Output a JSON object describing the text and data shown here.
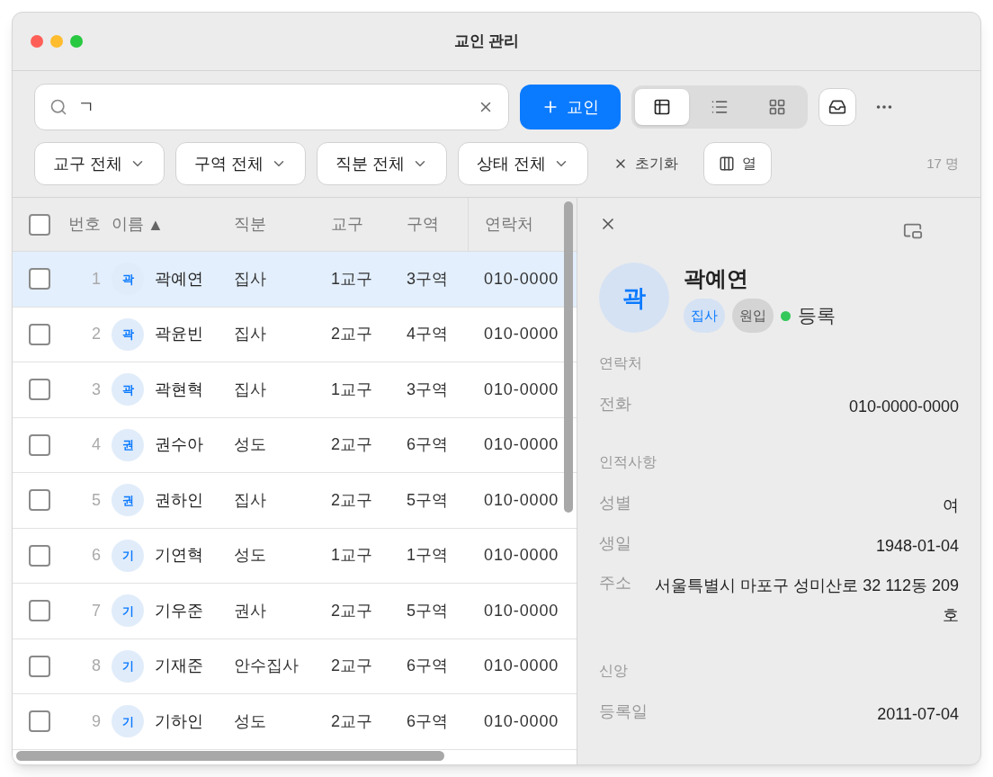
{
  "window": {
    "title": "교인 관리"
  },
  "search": {
    "value": "ㄱ"
  },
  "add_button": {
    "label": "교인"
  },
  "view_modes": [
    {
      "kind": "table",
      "selected": true
    },
    {
      "kind": "list",
      "selected": false
    },
    {
      "kind": "grid",
      "selected": false
    }
  ],
  "filters": [
    "교구 전체",
    "구역 전체",
    "직분 전체",
    "상태 전체"
  ],
  "reset_button": {
    "label": "초기화"
  },
  "columns_button": {
    "label": "열"
  },
  "count": "17 명",
  "table": {
    "columns": [
      {
        "label": "번호"
      },
      {
        "label": "이름",
        "sort_indicator": "▲"
      },
      {
        "label": "직분"
      },
      {
        "label": "교구"
      },
      {
        "label": "구역"
      },
      {
        "label": "연락처"
      }
    ],
    "all_checked": false,
    "rows": [
      {
        "checked": false,
        "selected": true,
        "number": "1",
        "initial": "곽",
        "name": "곽예연",
        "role": "집사",
        "parish": "1교구",
        "zone": "3구역",
        "phone": "010-0000"
      },
      {
        "checked": false,
        "selected": false,
        "number": "2",
        "initial": "곽",
        "name": "곽윤빈",
        "role": "집사",
        "parish": "2교구",
        "zone": "4구역",
        "phone": "010-0000"
      },
      {
        "checked": false,
        "selected": false,
        "number": "3",
        "initial": "곽",
        "name": "곽현혁",
        "role": "집사",
        "parish": "1교구",
        "zone": "3구역",
        "phone": "010-0000"
      },
      {
        "checked": false,
        "selected": false,
        "number": "4",
        "initial": "권",
        "name": "권수아",
        "role": "성도",
        "parish": "2교구",
        "zone": "6구역",
        "phone": "010-0000"
      },
      {
        "checked": false,
        "selected": false,
        "number": "5",
        "initial": "권",
        "name": "권하인",
        "role": "집사",
        "parish": "2교구",
        "zone": "5구역",
        "phone": "010-0000"
      },
      {
        "checked": false,
        "selected": false,
        "number": "6",
        "initial": "기",
        "name": "기연혁",
        "role": "성도",
        "parish": "1교구",
        "zone": "1구역",
        "phone": "010-0000"
      },
      {
        "checked": false,
        "selected": false,
        "number": "7",
        "initial": "기",
        "name": "기우준",
        "role": "권사",
        "parish": "2교구",
        "zone": "5구역",
        "phone": "010-0000"
      },
      {
        "checked": false,
        "selected": false,
        "number": "8",
        "initial": "기",
        "name": "기재준",
        "role": "안수집사",
        "parish": "2교구",
        "zone": "6구역",
        "phone": "010-0000"
      },
      {
        "checked": false,
        "selected": false,
        "number": "9",
        "initial": "기",
        "name": "기하인",
        "role": "성도",
        "parish": "2교구",
        "zone": "6구역",
        "phone": "010-0000"
      }
    ]
  },
  "detail": {
    "initial": "곽",
    "name": "곽예연",
    "tags": [
      {
        "label": "집사",
        "kind": "role"
      },
      {
        "label": "원입",
        "kind": "grade"
      }
    ],
    "status": {
      "label": "등록",
      "color": "#34c759"
    },
    "sections": [
      {
        "title": "연락처",
        "fields": [
          {
            "label": "전화",
            "value": "010-0000-0000"
          }
        ]
      },
      {
        "title": "인적사항",
        "fields": [
          {
            "label": "성별",
            "value": "여"
          },
          {
            "label": "생일",
            "value": "1948-01-04"
          },
          {
            "label": "주소",
            "value": "서울특별시 마포구 성미산로 32 112동 209호"
          }
        ]
      },
      {
        "title": "신앙",
        "fields": [
          {
            "label": "등록일",
            "value": "2011-07-04"
          }
        ]
      }
    ]
  }
}
